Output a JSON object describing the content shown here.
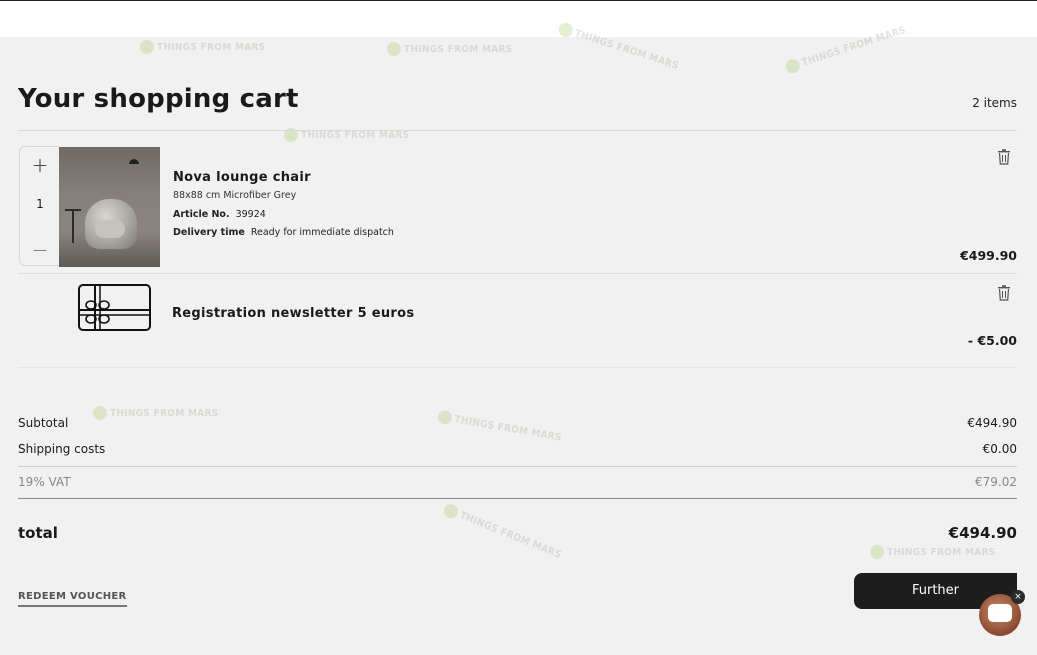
{
  "watermark": {
    "text": "THINGS FROM MARS"
  },
  "header": {
    "title": "Your shopping cart",
    "item_count": "2 items"
  },
  "items": [
    {
      "name": "Nova lounge chair",
      "variant": "88x88 cm Microfiber Grey",
      "article_label": "Article No.",
      "article_no": "39924",
      "delivery_label": "Delivery time",
      "delivery_value": "Ready for immediate dispatch",
      "quantity": "1",
      "plus_symbol": "+",
      "minus_symbol": "—",
      "price": "€499.90"
    },
    {
      "name": "Registration newsletter 5 euros",
      "price": "- €5.00"
    }
  ],
  "summary": {
    "subtotal_label": "Subtotal",
    "subtotal_value": "€494.90",
    "shipping_label": "Shipping costs",
    "shipping_value": "€0.00",
    "vat_label": "19% VAT",
    "vat_value": "€79.02",
    "total_label": "total",
    "total_value": "€494.90"
  },
  "actions": {
    "voucher_label": "REDEEM VOUCHER",
    "further_label": "Further",
    "chat_close_symbol": "×"
  },
  "icons": {
    "delete": "trash-icon",
    "voucher_image": "gift-card-icon",
    "chat": "chat-icon"
  },
  "colors": {
    "background": "#f1f1f1",
    "button": "#1d1d1d",
    "text": "#1a1a1a"
  }
}
